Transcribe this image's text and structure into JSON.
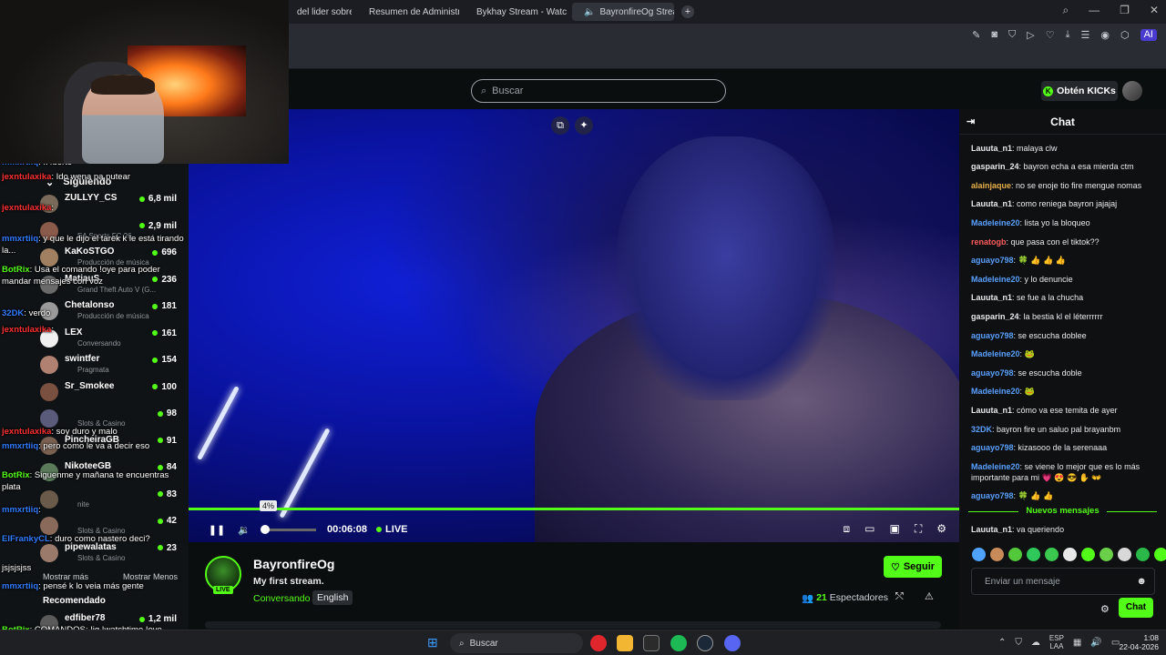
{
  "browser": {
    "tabs": [
      {
        "label": "del lider sobre la",
        "icon_color": "#1f2024",
        "active": false
      },
      {
        "label": "Resumen de Administraci",
        "icon_color": "#4f7cff",
        "active": false
      },
      {
        "label": "Bykhay Stream - Watch Li",
        "icon_color": "#53fc18",
        "active": false
      },
      {
        "label": "BayronfireOg Stream",
        "icon_color": "#53fc18",
        "active": true
      }
    ],
    "ai_label": "AI"
  },
  "header": {
    "search_placeholder": "Buscar",
    "get_kicks_label": "Obtén KICKs",
    "kicks_logo": "K"
  },
  "player": {
    "volume_tooltip": "4%",
    "time": "00:06:08",
    "live_label": "LIVE",
    "volume_level": 0.04
  },
  "stream": {
    "channel_name": "BayronfireOg",
    "title": "My first stream.",
    "category": "Conversando",
    "language": "English",
    "follow_label": "Seguir",
    "viewer_count": "21",
    "viewers_label": "Espectadores",
    "live_badge": "LIVE"
  },
  "chat": {
    "title": "Chat",
    "messages": [
      {
        "user": "Lauuta_n1",
        "color": "#e8eaec",
        "text": "malaya clw"
      },
      {
        "user": "gasparin_24",
        "color": "#e8eaec",
        "text": "bayron echa a esa mierda ctm"
      },
      {
        "user": "alainjaque",
        "color": "#e8b04a",
        "text": "no se enoje tio fire mengue nomas"
      },
      {
        "user": "Lauuta_n1",
        "color": "#e8eaec",
        "text": "como reniega bayron jajajaj"
      },
      {
        "user": "Madeleine20",
        "color": "#5aa0ff",
        "text": "lista yo la bloqueo"
      },
      {
        "user": "renatogb",
        "color": "#ff5b5b",
        "text": "que pasa con el tiktok??"
      },
      {
        "user": "aguayo798",
        "color": "#5aa0ff",
        "text": "🍀 👍 👍 👍"
      },
      {
        "user": "Madeleine20",
        "color": "#5aa0ff",
        "text": "y lo denuncie"
      },
      {
        "user": "Lauuta_n1",
        "color": "#e8eaec",
        "text": "se fue a la chucha"
      },
      {
        "user": "gasparin_24",
        "color": "#e8eaec",
        "text": "la bestia kl el léterrrrrr"
      },
      {
        "user": "aguayo798",
        "color": "#5aa0ff",
        "text": "se escucha doblee"
      },
      {
        "user": "Madeleine20",
        "color": "#5aa0ff",
        "text": "🐸"
      },
      {
        "user": "aguayo798",
        "color": "#5aa0ff",
        "text": "se escucha doble"
      },
      {
        "user": "Madeleine20",
        "color": "#5aa0ff",
        "text": "🐸"
      },
      {
        "user": "Lauuta_n1",
        "color": "#e8eaec",
        "text": "cómo va ese temita de ayer"
      },
      {
        "user": "32DK",
        "color": "#5aa0ff",
        "text": "bayron fire un saluo pal brayanbm"
      },
      {
        "user": "aguayo798",
        "color": "#5aa0ff",
        "text": "kizasooo de la serenaaa"
      },
      {
        "user": "Madeleine20",
        "color": "#5aa0ff",
        "text": "se viene lo mejor que es lo más importante para mi 💗 😍 😎 ✋ 👐"
      },
      {
        "user": "aguayo798",
        "color": "#5aa0ff",
        "text": "🍀 👍 👍"
      }
    ],
    "new_messages_label": "Nuevos mensajes",
    "latest_message": {
      "user": "Lauuta_n1",
      "text": "va queriendo"
    },
    "input_placeholder": "Enviar un mensaje",
    "send_label": "Chat",
    "emote_colors": [
      "#4fa3ff",
      "#c98a5a",
      "#53c83a",
      "#2fc85a",
      "#3ac84f",
      "#e8e8e8",
      "#53fc18",
      "#6ad04a",
      "#d8d8d8",
      "#2ab848",
      "#53fc18",
      "#d89a4a",
      "#3ac84f"
    ]
  },
  "sidebar": {
    "heading": "Siguiendo",
    "channels": [
      {
        "name": "ZULLYY_CS",
        "category": "",
        "viewers": "6,8 mil",
        "color": "#7a6a5a"
      },
      {
        "name": "",
        "category": "EA Sports FC 26",
        "viewers": "2,9 mil",
        "color": "#8a5a4a"
      },
      {
        "name": "KaKoSTGO",
        "category": "Producción de música",
        "viewers": "696",
        "color": "#a08060"
      },
      {
        "name": "MatiauS",
        "category": "Grand Theft Auto V (G...",
        "viewers": "236",
        "color": "#6a6a6a"
      },
      {
        "name": "Chetalonso",
        "category": "Producción de música",
        "viewers": "181",
        "color": "#9a9a9a"
      },
      {
        "name": "LEX",
        "category": "Conversando",
        "viewers": "161",
        "color": "#f0f0f0"
      },
      {
        "name": "swintfer",
        "category": "Pragmata",
        "viewers": "154",
        "color": "#b08070"
      },
      {
        "name": "Sr_Smokee",
        "category": "",
        "viewers": "100",
        "color": "#7a5040"
      },
      {
        "name": "",
        "category": "Slots & Casino",
        "viewers": "98",
        "color": "#5a5a7a"
      },
      {
        "name": "PincheiraGB",
        "category": "",
        "viewers": "91",
        "color": "#7a6050"
      },
      {
        "name": "NikoteeGB",
        "category": "",
        "viewers": "84",
        "color": "#5a7a5a"
      },
      {
        "name": "",
        "category": "nite",
        "viewers": "83",
        "color": "#6a5a4a"
      },
      {
        "name": "",
        "category": "Slots & Casino",
        "viewers": "42",
        "color": "#8a6a5a"
      },
      {
        "name": "pipewalatas",
        "category": "Slots & Casino",
        "viewers": "23",
        "color": "#9a7a6a"
      }
    ],
    "show_more": "Mostrar más",
    "show_less": "Mostrar Menos",
    "recommended_heading": "Recomendado",
    "recommended": {
      "name": "edfiber78",
      "viewers": "1,2 mil",
      "color": "#5a5a5a"
    }
  },
  "overlay_chat": [
    {
      "user": "mmxrtiiq",
      "color": "#2f7bff",
      "text": "k fuerte"
    },
    {
      "user": "jexntulaxika",
      "color": "#ff3030",
      "text": "Ido wena pa putear"
    },
    {
      "user": "jexntulaxika",
      "color": "#ff3030",
      "text": ""
    },
    {
      "user": "mmxrtiiq",
      "color": "#2f7bff",
      "text": "y que le dijo el tarek k le está tirando la..."
    },
    {
      "user": "BotRix",
      "color": "#53fc18",
      "text": "Usa el comando !oye para poder mandar mensajes con voz"
    },
    {
      "user": "32DK",
      "color": "#2f7bff",
      "text": "verdo"
    },
    {
      "user": "jexntulaxika",
      "color": "#ff3030",
      "text": ""
    },
    {
      "user": "jexntulaxika",
      "color": "#ff3030",
      "text": "soy duro y malo"
    },
    {
      "user": "mmxrtiiq",
      "color": "#2f7bff",
      "text": "pero como le va a decir eso"
    },
    {
      "user": "BotRix",
      "color": "#53fc18",
      "text": "Siguenme y mañana te encuentras plata"
    },
    {
      "user": "mmxrtiiq",
      "color": "#2f7bff",
      "text": ""
    },
    {
      "user": "ElFrankyCL",
      "color": "#2f7bff",
      "text": "duro como nastero deci?"
    },
    {
      "user": "",
      "color": "#ff3030",
      "text": "jsjsjsjss"
    },
    {
      "user": "mmxrtiiq",
      "color": "#2f7bff",
      "text": "pensé k lo veia más gente"
    },
    {
      "user": "BotRix",
      "color": "#53fc18",
      "text": "COMANDOS: !ig !watchtime !oye !tiktok"
    }
  ],
  "taskbar": {
    "search_label": "Buscar",
    "lang_top": "ESP",
    "lang_bottom": "LAA",
    "time": "1:08",
    "date": "22-04-2026"
  }
}
